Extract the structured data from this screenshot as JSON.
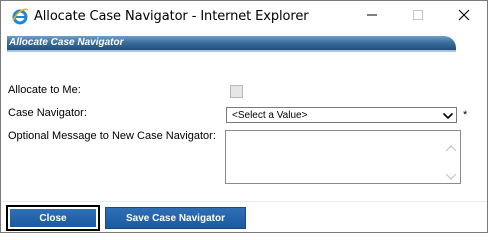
{
  "window": {
    "title": "Allocate Case Navigator - Internet Explorer"
  },
  "header": {
    "title": "Allocate Case Navigator"
  },
  "form": {
    "allocate_label": "Allocate to Me:",
    "allocate_checked": false,
    "navigator_label": "Case Navigator:",
    "navigator_selected": "<Select a Value>",
    "required_marker": "*",
    "message_label": "Optional Message to New Case Navigator:",
    "message_value": ""
  },
  "buttons": {
    "close_label": "Close",
    "save_label": "Save Case Navigator"
  },
  "colors": {
    "button_blue": "#1d5aa0",
    "header_blue": "#3d6e9c"
  }
}
